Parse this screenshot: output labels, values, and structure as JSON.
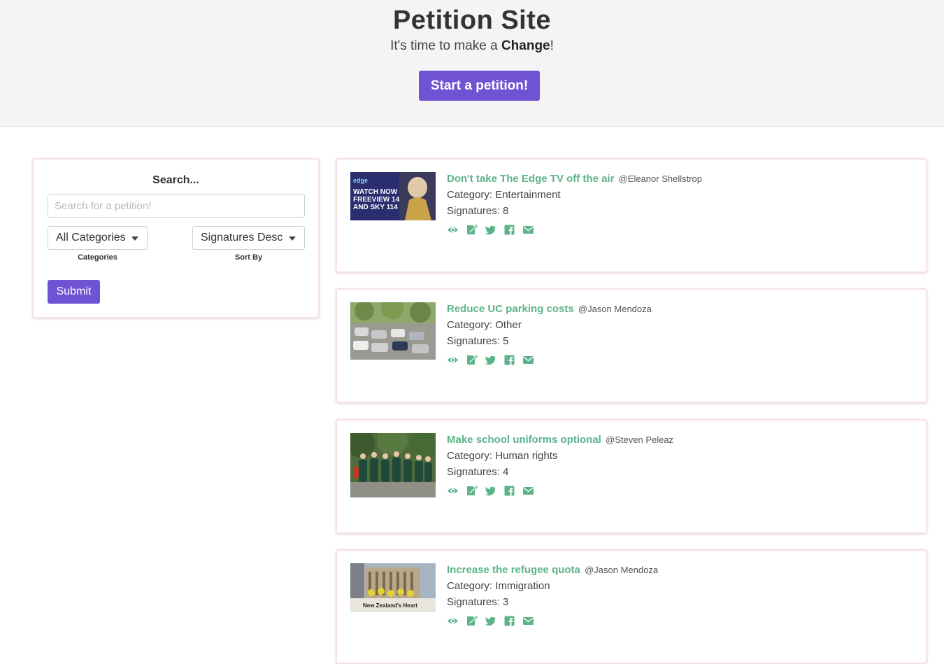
{
  "hero": {
    "title": "Petition Site",
    "subtitle_prefix": "It's time to make a ",
    "subtitle_bold": "Change",
    "subtitle_suffix": "!",
    "start_button": "Start a petition!"
  },
  "search": {
    "heading": "Search...",
    "placeholder": "Search for a petition!",
    "category_value": "All Categories",
    "category_label": "Categories",
    "sort_value": "Signatures Desc",
    "sort_label": "Sort By",
    "submit": "Submit"
  },
  "petitions": [
    {
      "title": "Don't take The Edge TV off the air",
      "author": "@Eleanor Shellstrop",
      "category": "Category: Entertainment",
      "signatures": "Signatures: 8",
      "image_text": [
        "edge",
        "WATCH NOW",
        "FREEVIEW 14",
        "AND SKY 114"
      ]
    },
    {
      "title": "Reduce UC parking costs",
      "author": "@Jason Mendoza",
      "category": "Category: Other",
      "signatures": "Signatures: 5"
    },
    {
      "title": "Make school uniforms optional",
      "author": "@Steven Peleaz",
      "category": "Category: Human rights",
      "signatures": "Signatures: 4"
    },
    {
      "title": "Increase the refugee quota",
      "author": "@Jason Mendoza",
      "category": "Category: Immigration",
      "signatures": "Signatures: 3",
      "image_text": [
        "New Zealand's Heart"
      ]
    }
  ],
  "icons": [
    "eye-icon",
    "sign-icon",
    "twitter-icon",
    "facebook-icon",
    "envelope-icon"
  ],
  "colors": {
    "accent": "#6f53d2",
    "link": "#5cb38a",
    "hero_bg": "#f4f4f5"
  }
}
